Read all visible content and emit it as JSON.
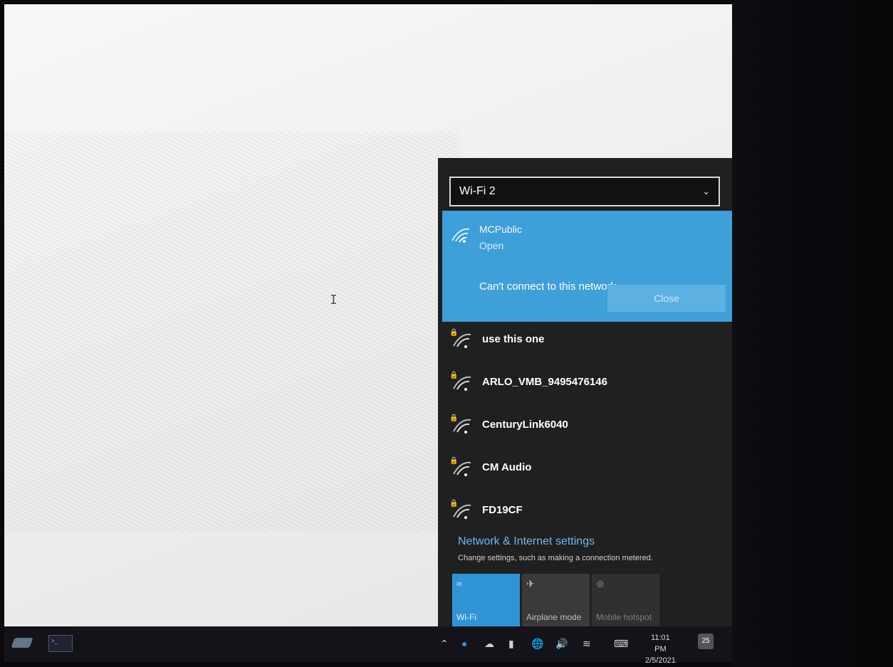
{
  "flyout": {
    "adapter": "Wi-Fi 2",
    "active_network": {
      "name": "MCPublic",
      "status": "Open",
      "error": "Can't connect to this network",
      "close_label": "Close"
    },
    "networks": [
      {
        "name": "use this one",
        "secured": true
      },
      {
        "name": "ARLO_VMB_9495476146",
        "secured": true
      },
      {
        "name": "CenturyLink6040",
        "secured": true
      },
      {
        "name": "CM Audio",
        "secured": true
      },
      {
        "name": "FD19CF",
        "secured": true
      }
    ],
    "settings_link": "Network & Internet settings",
    "settings_desc": "Change settings, such as making a connection metered.",
    "tiles": {
      "wifi": "Wi-Fi",
      "airplane": "Airplane mode",
      "hotspot": "Mobile hotspot"
    }
  },
  "taskbar": {
    "time": "11:01 PM",
    "date": "2/5/2021",
    "notification_count": "25"
  },
  "colors": {
    "accent": "#3e9fd9",
    "flyout_bg": "#202020",
    "link": "#6fb6ee"
  }
}
